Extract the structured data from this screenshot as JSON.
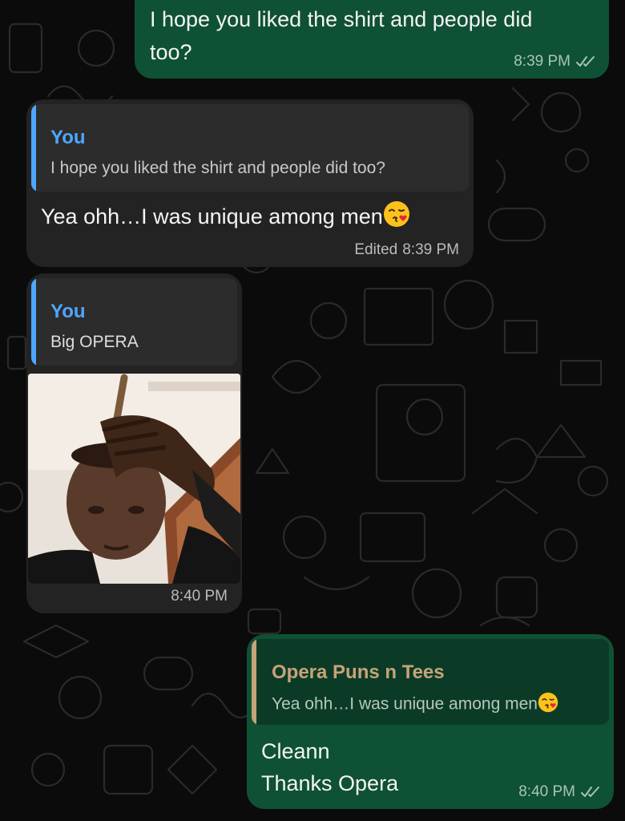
{
  "messages": [
    {
      "id": "m1",
      "direction": "outgoing",
      "text_line1": "I hope you liked the shirt and people did",
      "text_line2": "too?",
      "time": "8:39 PM",
      "status": "read"
    },
    {
      "id": "m2",
      "direction": "incoming",
      "reply": {
        "author": "You",
        "text": "I hope you liked the shirt and people did too?"
      },
      "text": "Yea ohh…I was unique among men",
      "emoji": "face-blowing-kiss",
      "time": "8:39 PM",
      "edited_label": "Edited"
    },
    {
      "id": "m3",
      "direction": "incoming",
      "reply": {
        "author": "You",
        "text": "Big OPERA"
      },
      "media": "photo",
      "time": "8:40 PM"
    },
    {
      "id": "m4",
      "direction": "outgoing",
      "reply": {
        "author": "Opera Puns n Tees",
        "text": "Yea ohh…I was unique among men",
        "emoji": "face-blowing-kiss"
      },
      "text_line1": "Cleann",
      "text_line2": "Thanks Opera",
      "time": "8:40 PM",
      "status": "read"
    }
  ],
  "colors": {
    "background": "#0b0b0b",
    "outgoing_bubble": "#0f5135",
    "incoming_bubble": "#232323",
    "quote_you": "#4ea7ff",
    "quote_contact": "#c6a37a"
  }
}
